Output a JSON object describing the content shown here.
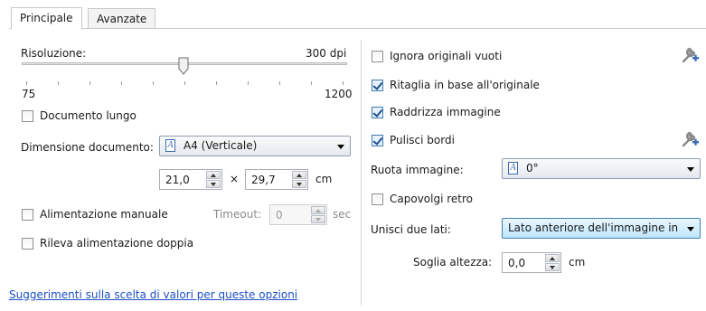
{
  "tabs": [
    {
      "label": "Principale",
      "active": true
    },
    {
      "label": "Avanzate",
      "active": false
    }
  ],
  "left": {
    "resolution": {
      "label": "Risoluzione:",
      "value_text": "300 dpi",
      "min_label": "75",
      "max_label": "1200",
      "value": 300
    },
    "long_document": {
      "label": "Documento lungo",
      "checked": false
    },
    "document_size": {
      "label": "Dimensione documento:",
      "value": "A4 (Verticale)"
    },
    "width": {
      "value": "21,0"
    },
    "times_symbol": "×",
    "height": {
      "value": "29,7"
    },
    "unit_cm": "cm",
    "manual_feed": {
      "label": "Alimentazione manuale",
      "checked": false
    },
    "timeout": {
      "label": "Timeout:",
      "value": "0",
      "unit": "sec"
    },
    "double_feed": {
      "label": "Rileva alimentazione doppia",
      "checked": false
    }
  },
  "right": {
    "ignore_blank": {
      "label": "Ignora originali vuoti",
      "checked": false
    },
    "crop": {
      "label": "Ritaglia in base all'originale",
      "checked": true
    },
    "deskew": {
      "label": "Raddrizza immagine",
      "checked": true
    },
    "clean_edges": {
      "label": "Pulisci bordi",
      "checked": true
    },
    "rotate": {
      "label": "Ruota immagine:",
      "value": "0°"
    },
    "flip_back": {
      "label": "Capovolgi retro",
      "checked": false
    },
    "merge_sides": {
      "label": "Unisci due lati:",
      "value": "Lato anteriore dell'immagine in"
    },
    "height_threshold": {
      "label": "Soglia altezza:",
      "value": "0,0",
      "unit": "cm"
    }
  },
  "footer": {
    "link": "Suggerimenti sulla scelta di valori per queste opzioni"
  },
  "icons": {
    "settings": "wrench-plus-icon",
    "document": "document-page-icon"
  },
  "colors": {
    "accent": "#3c7fb1",
    "link": "#1b4fc4"
  }
}
